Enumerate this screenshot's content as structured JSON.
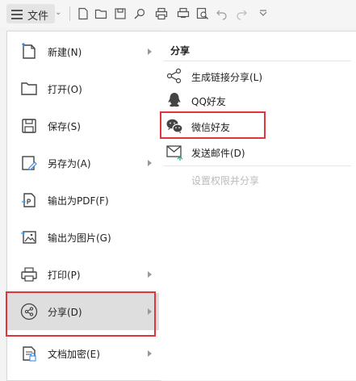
{
  "toolbar": {
    "file_label": "文件",
    "icons": [
      "new-doc-icon",
      "open-folder-icon",
      "save-icon",
      "find-icon",
      "print-icon",
      "print-preview-icon",
      "zoom-icon",
      "undo-icon",
      "redo-icon",
      "more-icon"
    ]
  },
  "menu": {
    "items": [
      {
        "label": "新建(N)",
        "icon": "new-doc-icon",
        "has_submenu": true
      },
      {
        "label": "打开(O)",
        "icon": "open-folder-icon",
        "has_submenu": false
      },
      {
        "label": "保存(S)",
        "icon": "save-icon",
        "has_submenu": false
      },
      {
        "label": "另存为(A)",
        "icon": "save-as-icon",
        "has_submenu": true
      },
      {
        "label": "输出为PDF(F)",
        "icon": "export-pdf-icon",
        "has_submenu": false
      },
      {
        "label": "输出为图片(G)",
        "icon": "export-image-icon",
        "has_submenu": false
      },
      {
        "label": "打印(P)",
        "icon": "print-icon",
        "has_submenu": true
      },
      {
        "label": "分享(D)",
        "icon": "share-icon",
        "has_submenu": true,
        "active": true
      },
      {
        "label": "文档加密(E)",
        "icon": "encrypt-doc-icon",
        "has_submenu": true
      }
    ]
  },
  "submenu": {
    "title": "分享",
    "items": [
      {
        "label": "生成链接分享(L)",
        "icon": "share-link-icon"
      },
      {
        "label": "QQ好友",
        "icon": "qq-icon"
      },
      {
        "label": "微信好友",
        "icon": "wechat-icon"
      },
      {
        "label": "发送邮件(D)",
        "icon": "mail-icon"
      },
      {
        "label": "设置权限并分享",
        "icon": "",
        "disabled": true
      }
    ]
  },
  "colors": {
    "highlight": "#e0353a",
    "active_bg": "#dedede"
  }
}
